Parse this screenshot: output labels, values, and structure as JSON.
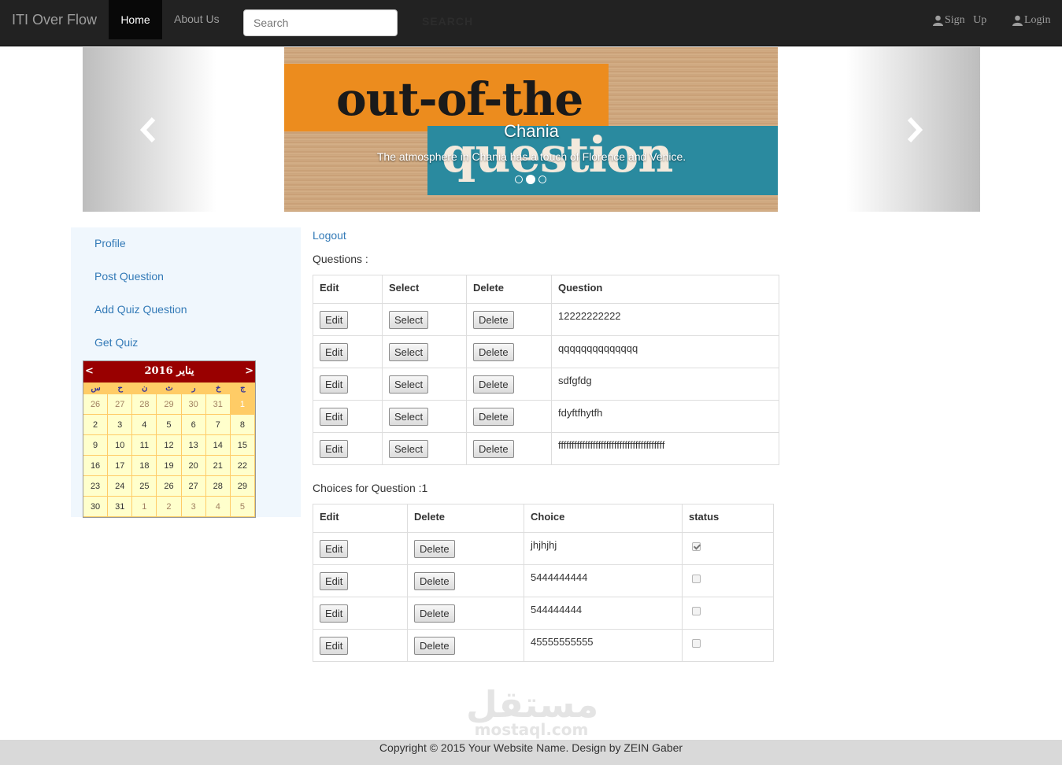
{
  "navbar": {
    "brand": "ITI Over Flow",
    "home": "Home",
    "about": "About Us",
    "search_placeholder": "Search",
    "search_button": "SEARCH",
    "signup": "Sign   Up",
    "login": "Login"
  },
  "carousel": {
    "caption_title": "Chania",
    "caption_text": "The atmosphere in Chania has a touch of Florence and Venice.",
    "image_text_line1": "out-of-the",
    "image_text_line2": "question",
    "indicator_count": 3,
    "active_indicator": 2
  },
  "sidebar": {
    "items": [
      "Profile",
      "Post Question",
      "Add Quiz Question",
      "Get Quiz"
    ]
  },
  "calendar": {
    "prev": "<",
    "next": ">",
    "title": "يناير 2016",
    "days_of_week": [
      "س",
      "ح",
      "ن",
      "ث",
      "ر",
      "خ",
      "ج"
    ],
    "weeks": [
      [
        "26",
        "27",
        "28",
        "29",
        "30",
        "31",
        "1"
      ],
      [
        "2",
        "3",
        "4",
        "5",
        "6",
        "7",
        "8"
      ],
      [
        "9",
        "10",
        "11",
        "12",
        "13",
        "14",
        "15"
      ],
      [
        "16",
        "17",
        "18",
        "19",
        "20",
        "21",
        "22"
      ],
      [
        "23",
        "24",
        "25",
        "26",
        "27",
        "28",
        "29"
      ],
      [
        "30",
        "31",
        "1",
        "2",
        "3",
        "4",
        "5"
      ]
    ],
    "selected_day": "1"
  },
  "main": {
    "logout": "Logout",
    "questions_label": "Questions :",
    "questions_table": {
      "headers": [
        "Edit",
        "Select",
        "Delete",
        "Question"
      ],
      "edit_label": "Edit",
      "select_label": "Select",
      "delete_label": "Delete",
      "rows": [
        "12222222222",
        "qqqqqqqqqqqqqq",
        "sdfgfdg",
        "fdyftfhytfh",
        "ffffffffffffffffffffffffffffffffffffffff"
      ]
    },
    "choices_label": "Choices for Question :1",
    "choices_table": {
      "headers": [
        "Edit",
        "Delete",
        "Choice",
        "status"
      ],
      "edit_label": "Edit",
      "delete_label": "Delete",
      "rows": [
        {
          "choice": "jhjhjhj",
          "status": true
        },
        {
          "choice": "5444444444",
          "status": false
        },
        {
          "choice": "544444444",
          "status": false
        },
        {
          "choice": "45555555555",
          "status": false
        }
      ]
    }
  },
  "watermark": {
    "arabic": "مستقل",
    "latin": "mostaql.com"
  },
  "footer": {
    "text": "Copyright © 2015 Your Website Name. Design by ZEIN Gaber"
  }
}
